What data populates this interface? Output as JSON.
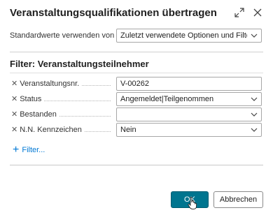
{
  "dialog": {
    "title": "Veranstaltungsqualifikationen übertragen"
  },
  "defaults": {
    "label": "Standardwerte verwenden von",
    "value": "Zuletzt verwendete Optionen und Filter"
  },
  "filter_section": {
    "title": "Filter: Veranstaltungsteilnehmer",
    "rows": [
      {
        "label": "Veranstaltungsnr.",
        "value": "V-00262"
      },
      {
        "label": "Status",
        "value": "Angemeldet|Teilgenommen"
      },
      {
        "label": "Bestanden",
        "value": ""
      },
      {
        "label": "N.N. Kennzeichen",
        "value": "Nein"
      }
    ],
    "add_filter_label": "Filter..."
  },
  "buttons": {
    "ok": "OK",
    "cancel": "Abbrechen"
  },
  "colors": {
    "accent": "#00758f",
    "link": "#0078d4"
  }
}
